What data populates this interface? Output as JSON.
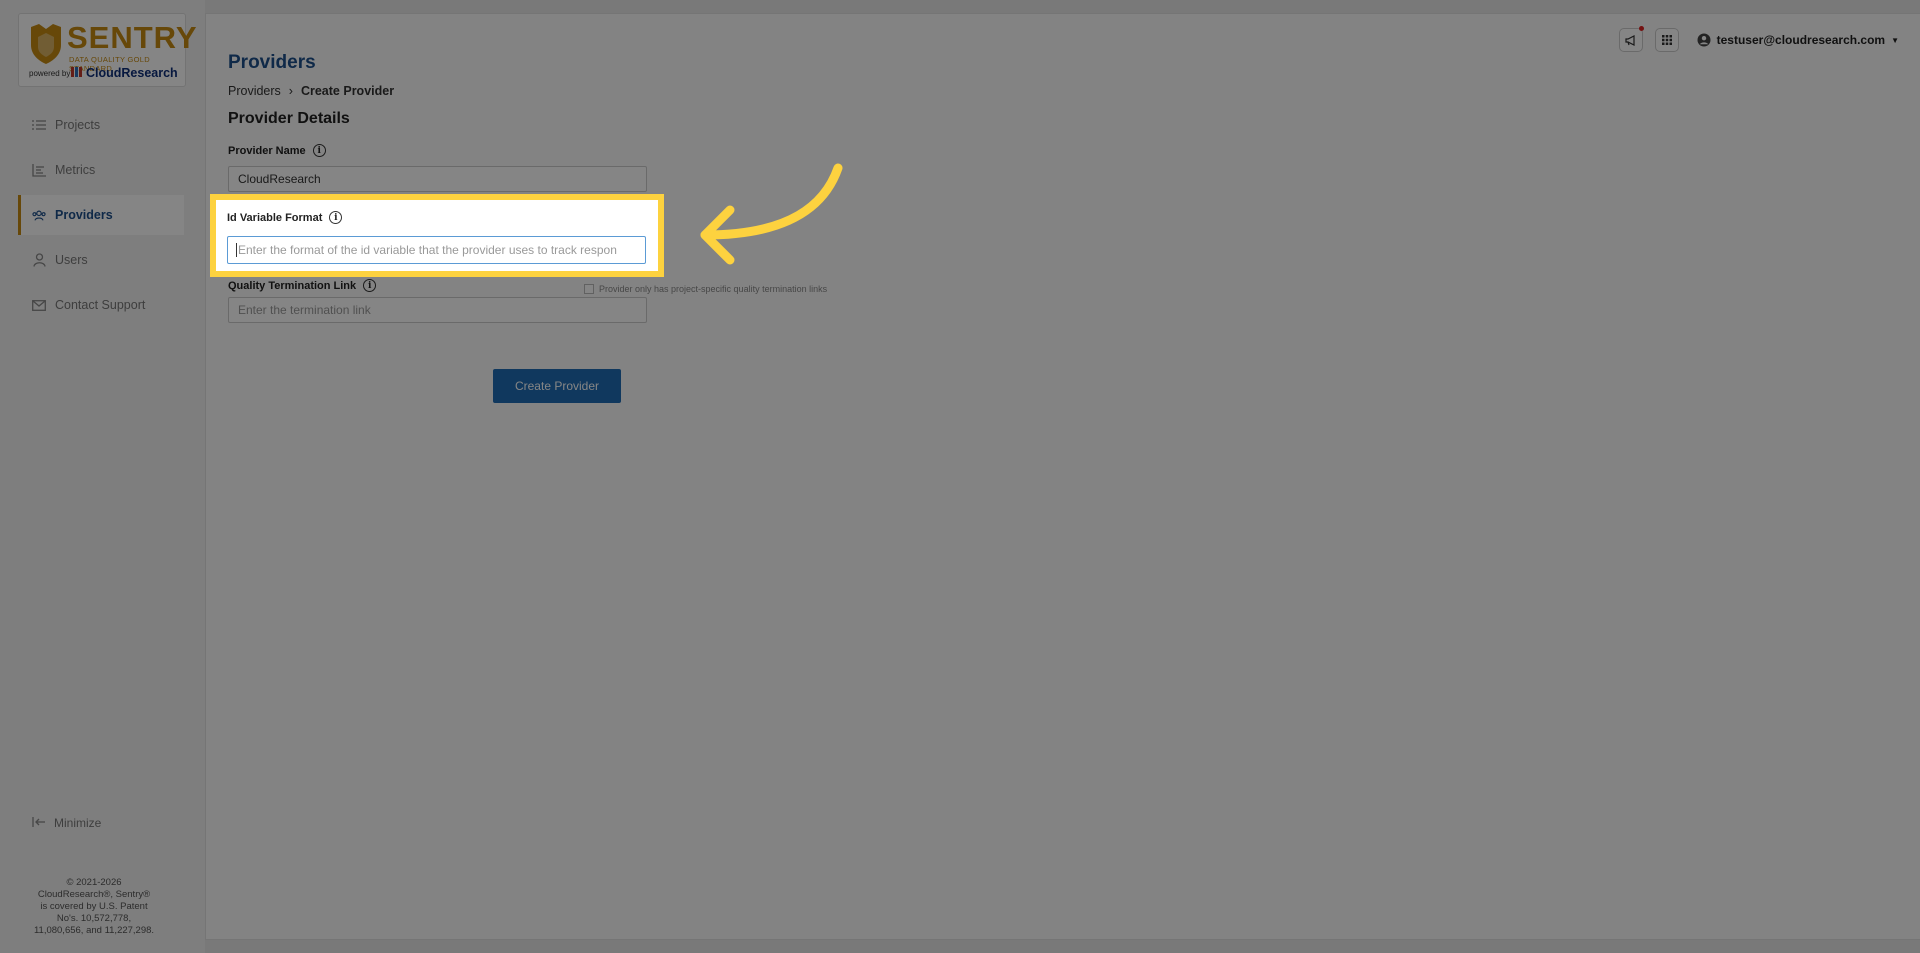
{
  "sidebar": {
    "logo": {
      "brand": "SENTRY",
      "tagline": "DATA QUALITY GOLD STANDARD",
      "powered_by": "powered by",
      "partner": "CloudResearch"
    },
    "items": [
      {
        "label": "Projects",
        "icon": "list-icon"
      },
      {
        "label": "Metrics",
        "icon": "bar-chart-icon"
      },
      {
        "label": "Providers",
        "icon": "users-group-icon",
        "active": true
      },
      {
        "label": "Users",
        "icon": "user-icon"
      },
      {
        "label": "Contact Support",
        "icon": "mail-icon"
      }
    ],
    "minimize_label": "Minimize",
    "copyright_lines": [
      "© 2021-2026",
      "CloudResearch®, Sentry®",
      "is covered by U.S. Patent",
      "No's. 10,572,778,",
      "11,080,656, and 11,227,298."
    ]
  },
  "header": {
    "user_email": "testuser@cloudresearch.com"
  },
  "page": {
    "title": "Providers",
    "breadcrumb": {
      "parent": "Providers",
      "separator": "›",
      "current": "Create Provider"
    },
    "section_title": "Provider Details",
    "fields": {
      "provider_name": {
        "label": "Provider Name",
        "value": "CloudResearch"
      },
      "id_variable_format": {
        "label": "Id Variable Format",
        "placeholder": "Enter the format of the id variable that the provider uses to track respon"
      },
      "quality_termination": {
        "label": "Quality Termination Link",
        "placeholder": "Enter the termination link",
        "checkbox_label": "Provider only has project-specific quality termination links"
      }
    },
    "submit_label": "Create Provider"
  },
  "colors": {
    "accent": "#1d4f8b",
    "brand_gold": "#c58a13",
    "highlight": "#fdd23f",
    "button": "#1f6cb5"
  }
}
